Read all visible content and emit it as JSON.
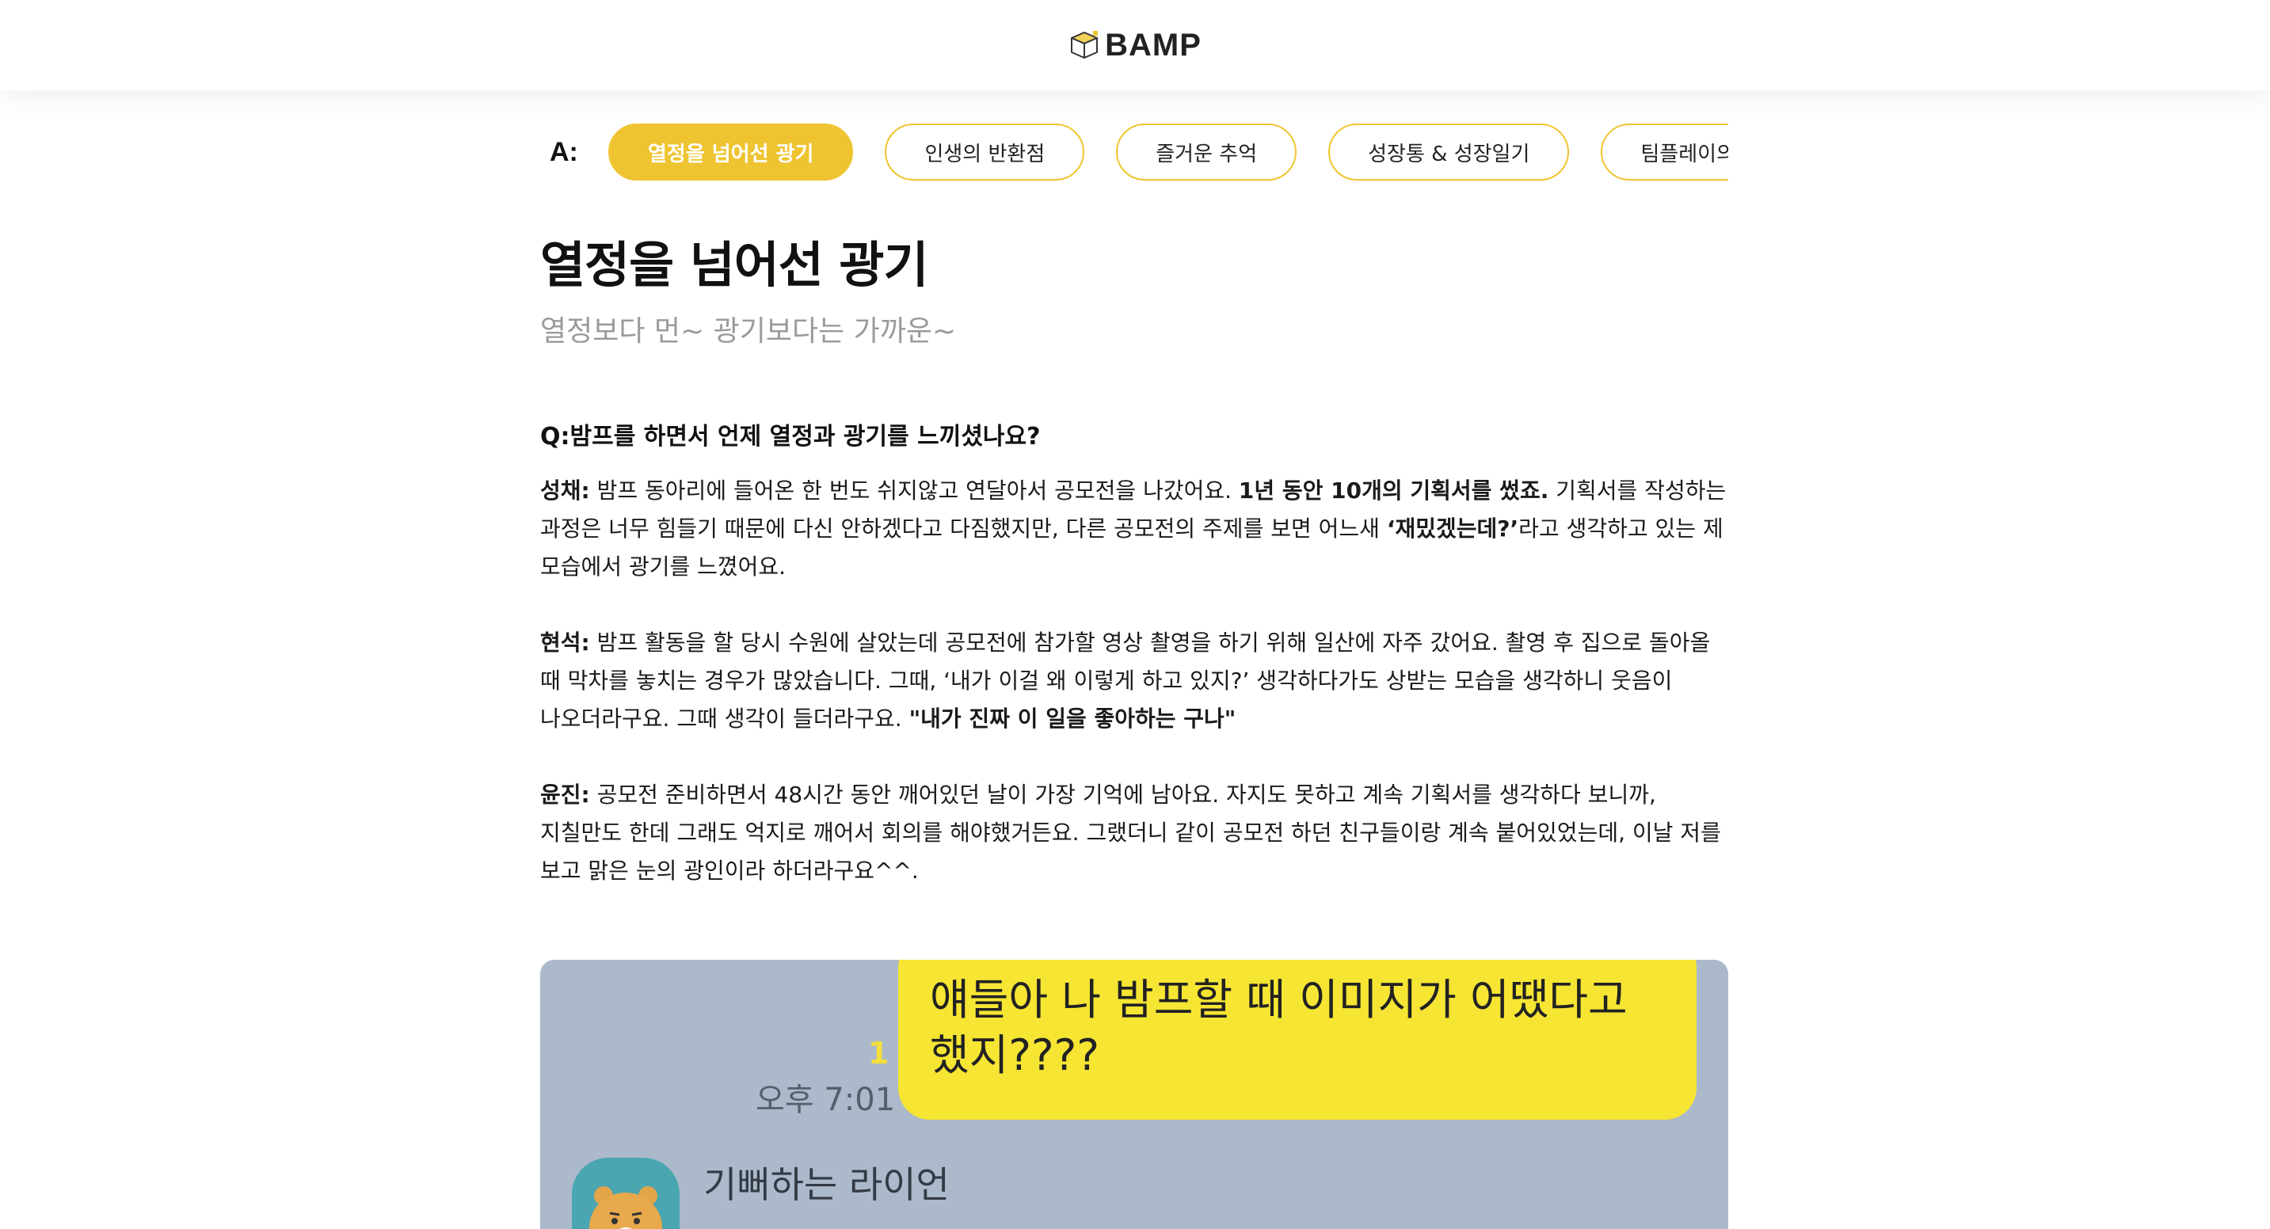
{
  "header": {
    "logo_text": "BAMP",
    "logo_icon": "box-icon",
    "accent": "#efc431"
  },
  "tabs": {
    "prefix": "A:",
    "items": [
      {
        "label": "열정을 넘어선 광기",
        "active": true
      },
      {
        "label": "인생의 반환점",
        "active": false
      },
      {
        "label": "즐거운 추억",
        "active": false
      },
      {
        "label": "성장통 & 성장일기",
        "active": false
      },
      {
        "label": "팀플레이의",
        "active": false
      }
    ]
  },
  "article": {
    "title": "열정을 넘어선 광기",
    "subtitle": "열정보다 먼~ 광기보다는 가까운~",
    "question": "Q:밤프를 하면서 언제 열정과 광기를 느끼셨나요?",
    "answers": [
      {
        "name": "성채:",
        "text1": " 밤프 동아리에 들어온 한 번도 쉬지않고 연달아서 공모전을 나갔어요. ",
        "bold1": "1년 동안 10개의 기획서를 썼죠.",
        "text2": " 기획서를 작성하는 과정은 너무 힘들기 때문에 다신 안하겠다고 다짐했지만, 다른 공모전의 주제를 보면 어느새 ",
        "bold2": "‘재밌겠는데?’",
        "text3": "라고 생각하고 있는 제 모습에서 광기를 느꼈어요."
      },
      {
        "name": "현석:",
        "text1": " 밤프 활동을 할 당시 수원에 살았는데 공모전에 참가할 영상 촬영을 하기 위해 일산에 자주 갔어요. 촬영 후 집으로 돌아올 때 막차를 놓치는 경우가 많았습니다. 그때, ‘내가 이걸 왜 이렇게 하고 있지?’ 생각하다가도 상받는 모습을 생각하니 웃음이 나오더라구요. 그때 생각이 들더라구요. ",
        "bold1": "\"내가 진짜 이 일을 좋아하는 구나\""
      },
      {
        "name": "윤진:",
        "text1": " 공모전 준비하면서 48시간 동안 깨어있던 날이 가장 기억에 남아요. 자지도 못하고 계속 기획서를 생각하다 보니까, 지칠만도 한데 그래도 억지로 깨어서 회의를 해야했거든요. 그랬더니 같이 공모전 하던 친구들이랑 계속 붙어있었는데, 이날 저를 보고 맑은 눈의 광인이라 하더라구요^^."
      }
    ]
  },
  "chat": {
    "background": "#abb9cb",
    "bubble_color": "#f6e533",
    "message": "얘들아 나 밤프할 때 이미지가 어땠다고 했지????",
    "unread": "1",
    "time": "오후 7:01",
    "sender": "기뻐하는 라이언"
  }
}
